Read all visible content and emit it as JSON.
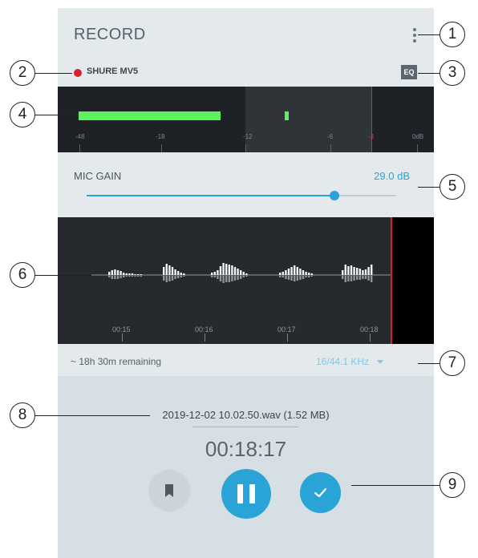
{
  "header": {
    "title": "RECORD",
    "device_name": "SHURE MV5",
    "eq_label": "EQ"
  },
  "meter": {
    "ticks": [
      "-48",
      "-18",
      "-12",
      "-6",
      "-3",
      "0dB"
    ],
    "level_fraction": 0.4,
    "peak_fraction": 0.58
  },
  "mic_gain": {
    "label": "MIC GAIN",
    "value": "29.0 dB",
    "fraction": 0.8
  },
  "waveform": {
    "times": [
      "00:15",
      "00:16",
      "00:17",
      "00:18"
    ]
  },
  "info": {
    "remaining": "~ 18h 30m remaining",
    "format": "16/44.1 KHz"
  },
  "recording": {
    "filename": "2019-12-02 10.02.50.wav (1.52 MB)",
    "elapsed": "00:18:17"
  },
  "callouts": [
    "1",
    "2",
    "3",
    "4",
    "5",
    "6",
    "7",
    "8",
    "9"
  ],
  "colors": {
    "accent": "#2aa3d6",
    "record_red": "#d3212f",
    "meter_green": "#5df25d"
  }
}
